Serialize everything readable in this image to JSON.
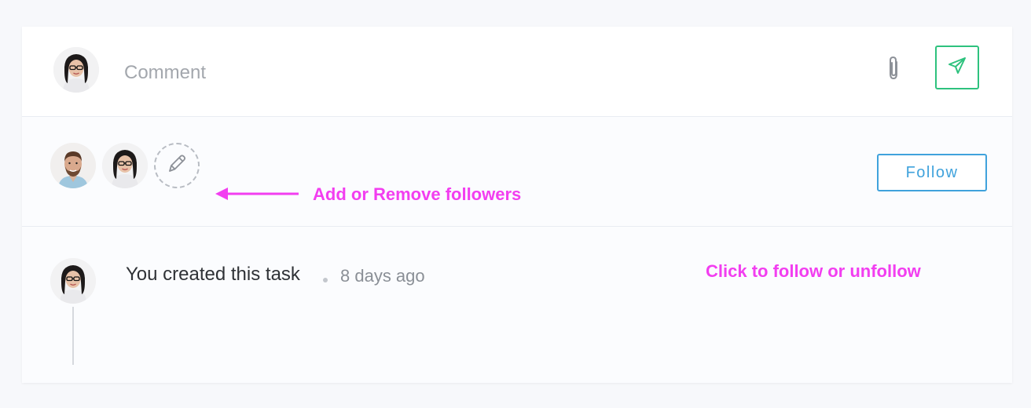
{
  "composer": {
    "placeholder": "Comment",
    "attach_icon": "paperclip-icon",
    "send_icon": "paper-plane-icon",
    "send_color": "#2ec27e"
  },
  "followers": {
    "avatars": [
      "follower-avatar-man",
      "follower-avatar-woman"
    ],
    "edit_icon": "pencil-icon",
    "follow_label": "Follow",
    "follow_color": "#3fa2dc"
  },
  "annotations": {
    "followers_hint": "Add or Remove followers",
    "follow_hint": "Click to follow or unfollow",
    "color": "#f23ef0"
  },
  "activity": {
    "text": "You created this task",
    "time": "8 days ago"
  }
}
